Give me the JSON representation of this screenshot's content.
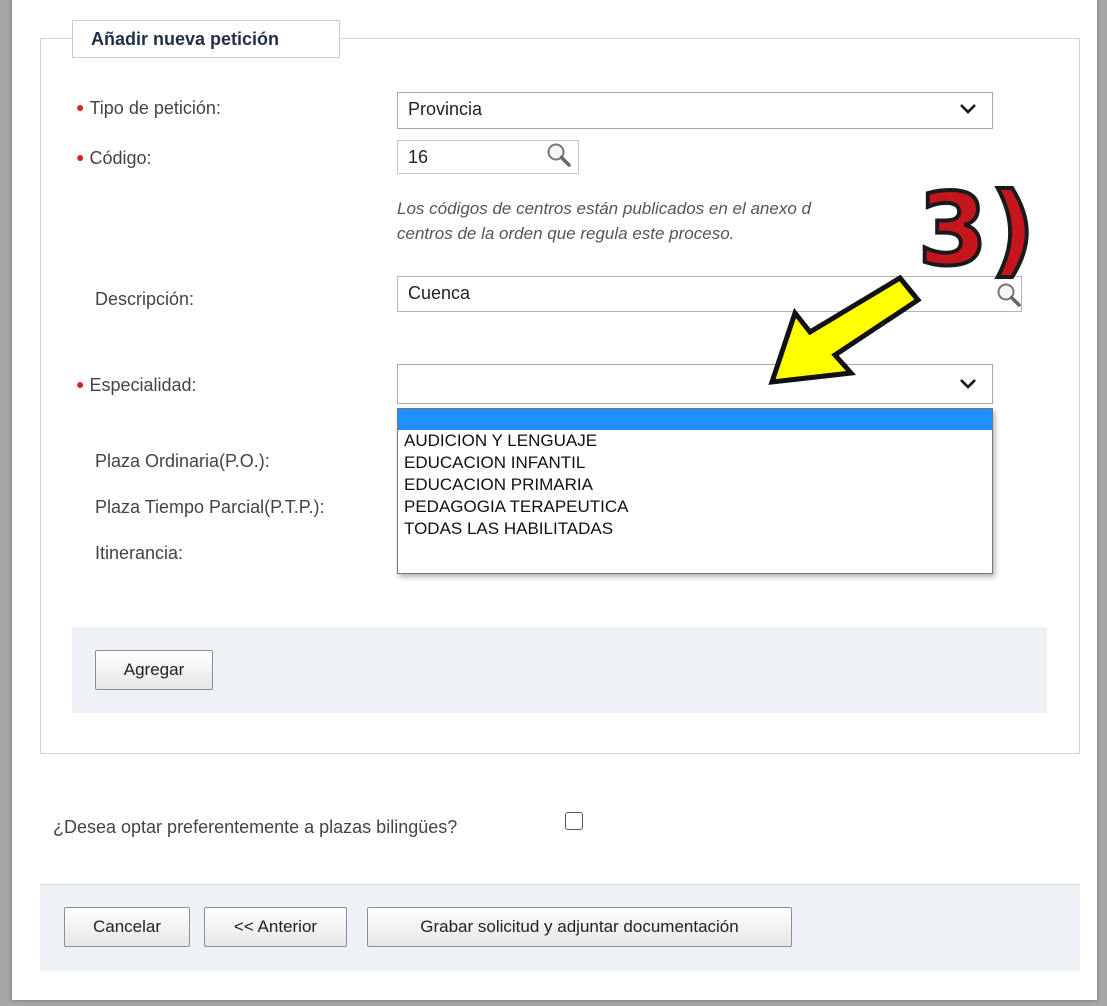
{
  "form": {
    "legend": "Añadir nueva petición",
    "fields": {
      "tipo": {
        "label": "Tipo de petición:",
        "value": "Provincia"
      },
      "codigo": {
        "label": "Código:",
        "value": "16"
      },
      "help_line1": "Los códigos de centros están publicados en el anexo d",
      "help_line2": "centros de la orden que regula este proceso.",
      "descripcion": {
        "label": "Descripción:",
        "value": "Cuenca"
      },
      "especialidad": {
        "label": "Especialidad:",
        "value": "",
        "options": [
          "",
          "AUDICION Y LENGUAJE",
          "EDUCACION INFANTIL",
          "EDUCACION PRIMARIA",
          "PEDAGOGIA TERAPEUTICA",
          "TODAS LAS HABILITADAS"
        ]
      },
      "plaza_ordinaria": "Plaza Ordinaria(P.O.):",
      "plaza_parcial": "Plaza Tiempo Parcial(P.T.P.):",
      "itinerancia": "Itinerancia:"
    },
    "add_button": "Agregar"
  },
  "bilingual": {
    "question": "¿Desea optar preferentemente a plazas bilingües?",
    "checked": false
  },
  "footer": {
    "cancel": "Cancelar",
    "previous": "<< Anterior",
    "save": "Grabar solicitud y adjuntar documentación"
  },
  "annotation": {
    "step": "3)",
    "arrow_color": "#ffff00",
    "step_color": "#c4161c"
  },
  "colors": {
    "required": "#d8232a",
    "selected_option": "#1e90ff",
    "bar_bg": "#eef1f6"
  }
}
